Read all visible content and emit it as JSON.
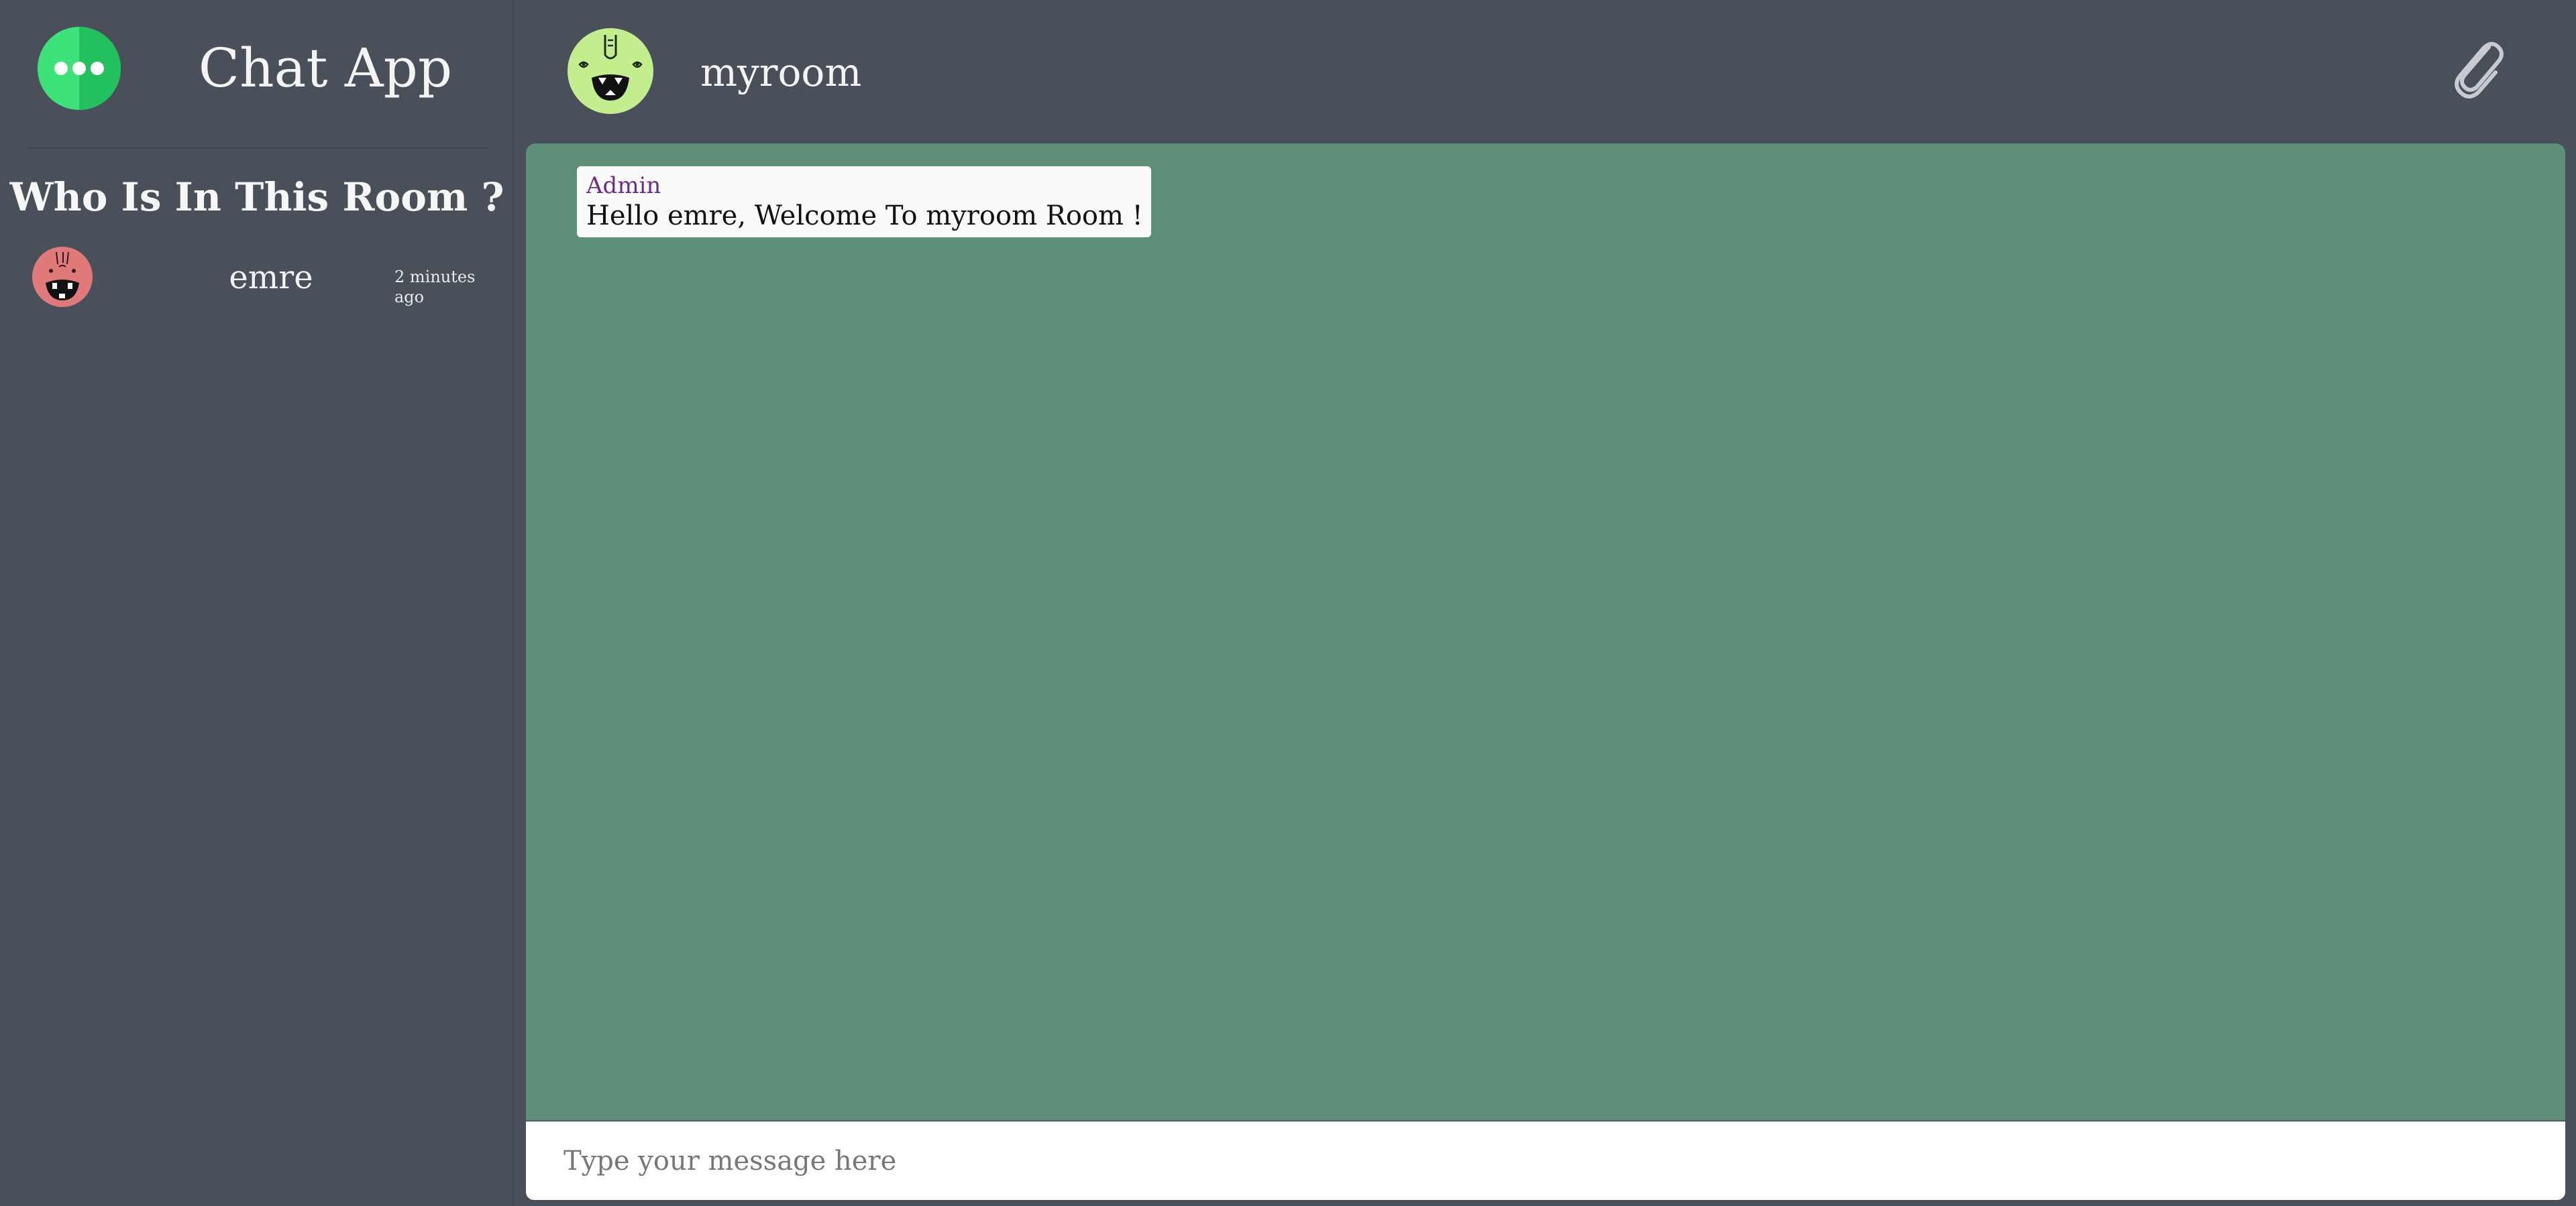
{
  "app": {
    "title": "Chat App",
    "brand_color": "#2ecc71"
  },
  "sidebar": {
    "heading": "Who Is In This Room ?",
    "members": [
      {
        "name": "emre",
        "joined": "2 minutes ago",
        "avatar_color": "#e57373",
        "avatar_icon": "monster-avatar-icon"
      }
    ]
  },
  "room": {
    "name": "myroom",
    "avatar_color": "#c5ef8f",
    "avatar_icon": "monster-avatar-icon",
    "attach_icon": "paperclip-icon"
  },
  "messages": [
    {
      "sender": "Admin",
      "text": "Hello emre, Welcome To myroom Room !"
    }
  ],
  "composer": {
    "placeholder": "Type your message here",
    "value": ""
  },
  "colors": {
    "background": "#4a5059",
    "chat_background": "#5e9079",
    "sender_color": "#6a2f83"
  }
}
